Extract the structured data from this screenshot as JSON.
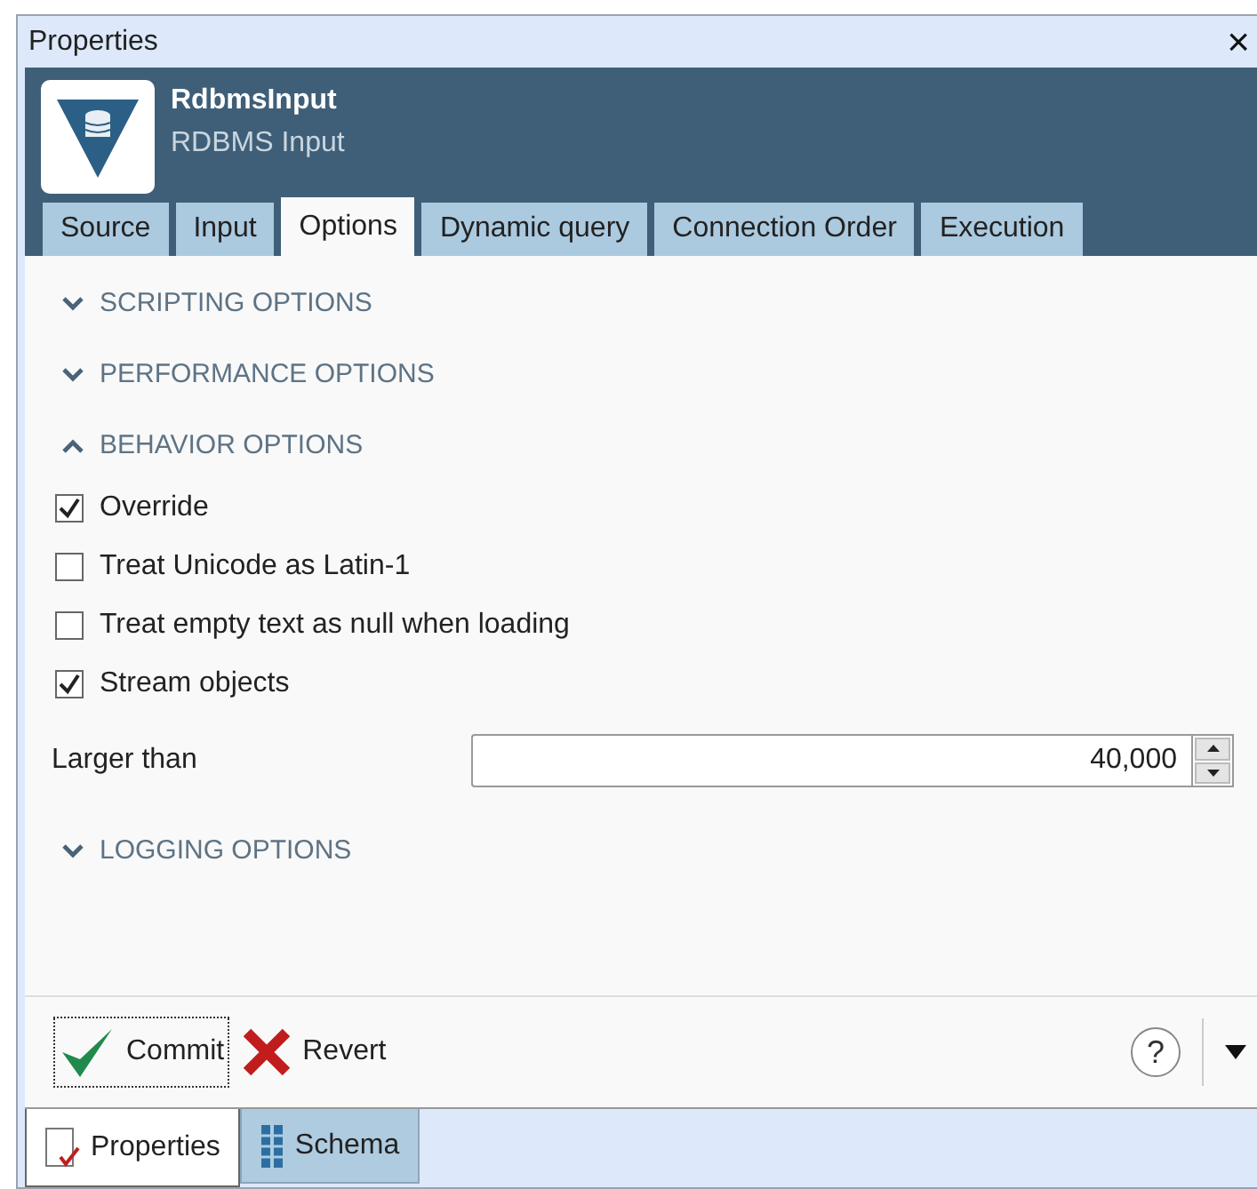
{
  "window": {
    "title": "Properties",
    "close": "×"
  },
  "header": {
    "name": "RdbmsInput",
    "type": "RDBMS Input"
  },
  "tabs": [
    {
      "label": "Source",
      "selected": false
    },
    {
      "label": "Input",
      "selected": false
    },
    {
      "label": "Options",
      "selected": true
    },
    {
      "label": "Dynamic query",
      "selected": false
    },
    {
      "label": "Connection Order",
      "selected": false
    },
    {
      "label": "Execution",
      "selected": false
    }
  ],
  "sections": [
    {
      "title": "SCRIPTING OPTIONS",
      "expanded": false
    },
    {
      "title": "PERFORMANCE OPTIONS",
      "expanded": false
    },
    {
      "title": "BEHAVIOR OPTIONS",
      "expanded": true,
      "items": [
        {
          "kind": "checkbox",
          "label": "Override",
          "checked": true
        },
        {
          "kind": "checkbox",
          "label": "Treat Unicode as Latin-1",
          "checked": false
        },
        {
          "kind": "checkbox",
          "label": "Treat empty text as null when loading",
          "checked": false
        },
        {
          "kind": "checkbox",
          "label": "Stream objects",
          "checked": true
        },
        {
          "kind": "number",
          "label": "Larger than",
          "value": "40,000"
        }
      ]
    },
    {
      "title": "LOGGING OPTIONS",
      "expanded": false
    }
  ],
  "toolbar": {
    "commit": "Commit",
    "revert": "Revert",
    "help": "?"
  },
  "bottom_tabs": [
    {
      "label": "Properties",
      "selected": true
    },
    {
      "label": "Schema",
      "selected": false
    }
  ]
}
